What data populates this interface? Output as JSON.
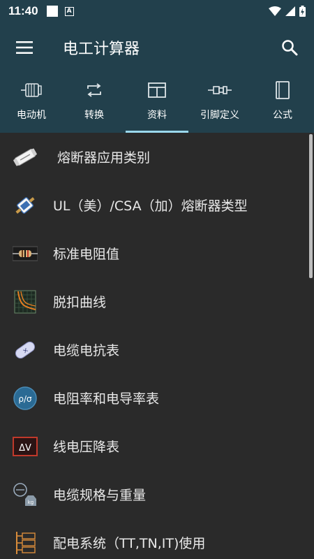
{
  "status_bar": {
    "time": "11:40",
    "a_glyph": "A"
  },
  "app_bar": {
    "title": "电工计算器"
  },
  "tabs": [
    {
      "label": "电动机",
      "icon": "motor-icon"
    },
    {
      "label": "转换",
      "icon": "convert-icon"
    },
    {
      "label": "资料",
      "icon": "data-table-icon",
      "active": true
    },
    {
      "label": "引脚定义",
      "icon": "pin-connector-icon"
    },
    {
      "label": "公式",
      "icon": "book-icon"
    }
  ],
  "list": [
    {
      "label": "熔断器应用类别",
      "icon": "fuse-icon"
    },
    {
      "label": "UL（美）/CSA（加）熔断器类型",
      "icon": "fuse-type-icon"
    },
    {
      "label": "标准电阻值",
      "icon": "resistor-icon"
    },
    {
      "label": "脱扣曲线",
      "icon": "trip-curve-icon"
    },
    {
      "label": "电缆电抗表",
      "icon": "cable-reactance-icon"
    },
    {
      "label": "电阻率和电导率表",
      "icon": "resistivity-icon",
      "glyph": "ρ/σ"
    },
    {
      "label": "线电压降表",
      "icon": "voltage-drop-icon",
      "glyph": "ΔV"
    },
    {
      "label": "电缆规格与重量",
      "icon": "cable-weight-icon",
      "glyph": "kg"
    },
    {
      "label": "配电系统（TT,TN,IT)使用",
      "icon": "distribution-system-icon"
    }
  ],
  "colors": {
    "header": "#22404c",
    "background": "#2a2a2a",
    "tab_indicator": "#9ad7ec"
  }
}
